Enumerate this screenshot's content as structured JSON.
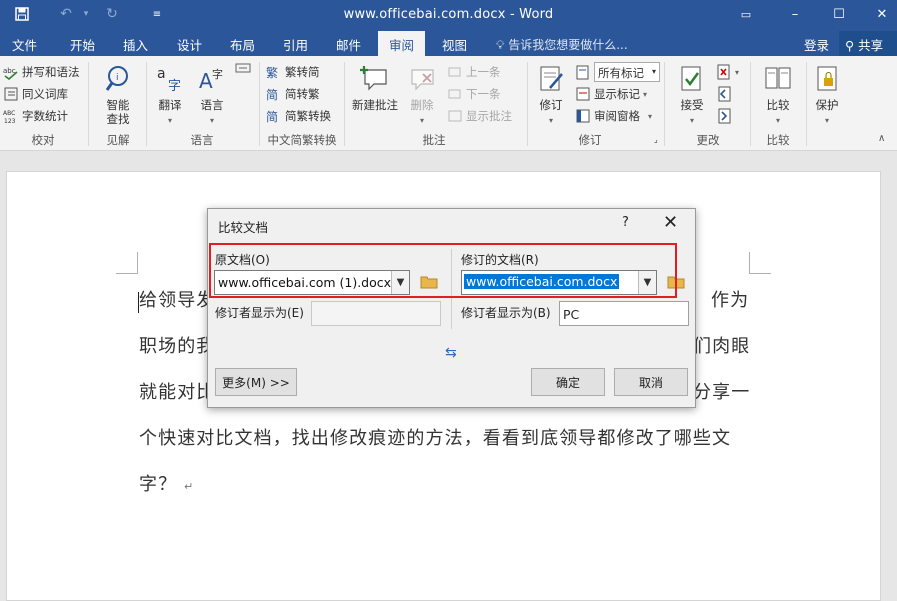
{
  "window": {
    "title": "www.officebai.com.docx - Word",
    "quick_access": {
      "save_icon": "save-icon",
      "undo_icon": "undo-icon",
      "redo_icon": "redo-icon",
      "customize_icon": "customize-icon"
    },
    "controls": {
      "ribbon_options": "ribbon-display-options-icon",
      "minimize": "–",
      "maximize": "☐",
      "close": "✕"
    }
  },
  "tabs": [
    {
      "label": "文件"
    },
    {
      "label": "开始"
    },
    {
      "label": "插入"
    },
    {
      "label": "设计"
    },
    {
      "label": "布局"
    },
    {
      "label": "引用"
    },
    {
      "label": "邮件"
    },
    {
      "label": "审阅",
      "active": true
    },
    {
      "label": "视图"
    }
  ],
  "tell_me": "告诉我您想要做什么...",
  "sign_in": "登录",
  "share": "共享",
  "ribbon": {
    "proofing": {
      "spell": "拼写和语法",
      "thesaurus": "同义词库",
      "word_count": "字数统计",
      "label": "校对"
    },
    "insights": {
      "smart_lookup": "智能查找",
      "label": "见解"
    },
    "language": {
      "translate": "翻译",
      "language": "语言",
      "label": "语言"
    },
    "chinese_conversion": {
      "to_simplified": "繁转简",
      "to_traditional": "简转繁",
      "conversion": "简繁转换",
      "label": "中文简繁转换"
    },
    "comments": {
      "new": "新建批注",
      "delete": "删除",
      "previous": "上一条",
      "next": "下一条",
      "show": "显示批注",
      "label": "批注"
    },
    "tracking": {
      "track": "修订",
      "markup_select": "所有标记",
      "show_markup": "显示标记",
      "reviewing_pane": "审阅窗格",
      "label": "修订"
    },
    "changes": {
      "accept": "接受",
      "label": "更改"
    },
    "compare": {
      "compare": "比较",
      "label": "比较"
    },
    "protect": {
      "protect": "保护"
    }
  },
  "document": {
    "lines": [
      "给领导发",
      "职场的我",
      "就能对比",
      "个快速对比文档，找出修改痕迹的方法，看看到底领导都修改了哪些文",
      "字？"
    ],
    "right_fragments": [
      "作为",
      "们肉眼",
      "分享一"
    ],
    "paragraph_mark": "↵"
  },
  "dialog": {
    "title": "比较文档",
    "help": "?",
    "close": "✕",
    "original_label": "原文档(O)",
    "original_value": "www.officebai.com (1).docx",
    "revised_label": "修订的文档(R)",
    "revised_value": "www.officebai.com.docx",
    "original_author_label": "修订者显示为(E)",
    "original_author_value": "",
    "revised_author_label": "修订者显示为(B)",
    "revised_author_value": "PC",
    "more_button": "更多(M) >>",
    "ok_button": "确定",
    "cancel_button": "取消",
    "swap_icon": "swap-arrows-icon"
  },
  "colors": {
    "word_blue": "#2b579a",
    "highlight": "#e02020",
    "selection": "#0078d7"
  }
}
